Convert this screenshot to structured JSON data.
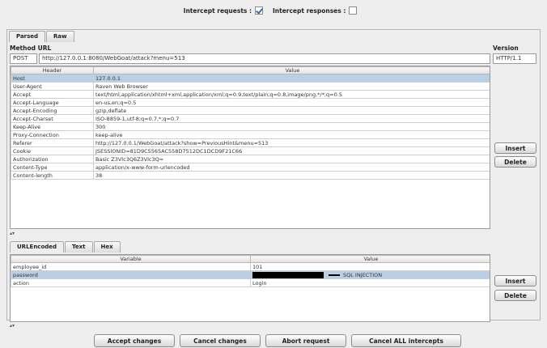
{
  "intercept": {
    "requests_label": "Intercept requests :",
    "requests_checked": true,
    "responses_label": "Intercept responses :",
    "responses_checked": false
  },
  "request_tabs": [
    {
      "label": "Parsed",
      "active": true
    },
    {
      "label": "Raw",
      "active": false
    }
  ],
  "request": {
    "method_url_label": "Method URL",
    "version_label": "Version",
    "method": "POST",
    "url": "http://127.0.0.1:8080/WebGoat/attack?menu=513",
    "version": "HTTP/1.1"
  },
  "headers_table": {
    "columns": [
      "Header",
      "Value"
    ],
    "rows": [
      {
        "header": "Host",
        "value": "127.0.0.1",
        "selected": true
      },
      {
        "header": "User-Agent",
        "value": "Raven Web Browser"
      },
      {
        "header": "Accept",
        "value": "text/html,application/xhtml+xml,application/xml;q=0.9,text/plain;q=0.8,image/png,*/*;q=0.5"
      },
      {
        "header": "Accept-Language",
        "value": "en-us,en;q=0.5"
      },
      {
        "header": "Accept-Encoding",
        "value": "gzip,deflate"
      },
      {
        "header": "Accept-Charset",
        "value": "ISO-8859-1,utf-8;q=0.7,*;q=0.7"
      },
      {
        "header": "Keep-Alive",
        "value": "300"
      },
      {
        "header": "Proxy-Connection",
        "value": "keep-alive"
      },
      {
        "header": "Referer",
        "value": "http://127.0.0.1/WebGoat/attack?show=PreviousHint&menu=513"
      },
      {
        "header": "Cookie",
        "value": "JSESSIONID=81D9C5565AC558D7512DC1DCD9F21C66"
      },
      {
        "header": "Authorization",
        "value": "Basic Z3Vlc3Q6Z3Vlc3Q="
      },
      {
        "header": "Content-Type",
        "value": "application/x-www-form-urlencoded"
      },
      {
        "header": "Content-length",
        "value": "38"
      }
    ],
    "insert_label": "Insert",
    "delete_label": "Delete"
  },
  "body_tabs": [
    {
      "label": "URLEncoded",
      "active": true
    },
    {
      "label": "Text",
      "active": false
    },
    {
      "label": "Hex",
      "active": false
    }
  ],
  "params_table": {
    "columns": [
      "Variable",
      "Value"
    ],
    "rows": [
      {
        "variable": "employee_id",
        "value": "101",
        "selected": false
      },
      {
        "variable": "password",
        "value": "SQL INJECTION",
        "selected": true,
        "redacted": true
      },
      {
        "variable": "action",
        "value": "Login",
        "selected": false
      }
    ],
    "insert_label": "Insert",
    "delete_label": "Delete"
  },
  "actions": {
    "accept": "Accept changes",
    "cancel": "Cancel changes",
    "abort": "Abort request",
    "cancel_all": "Cancel ALL intercepts"
  },
  "colors": {
    "selection": "#b8cfe5",
    "window_bg": "#eeeeee"
  }
}
